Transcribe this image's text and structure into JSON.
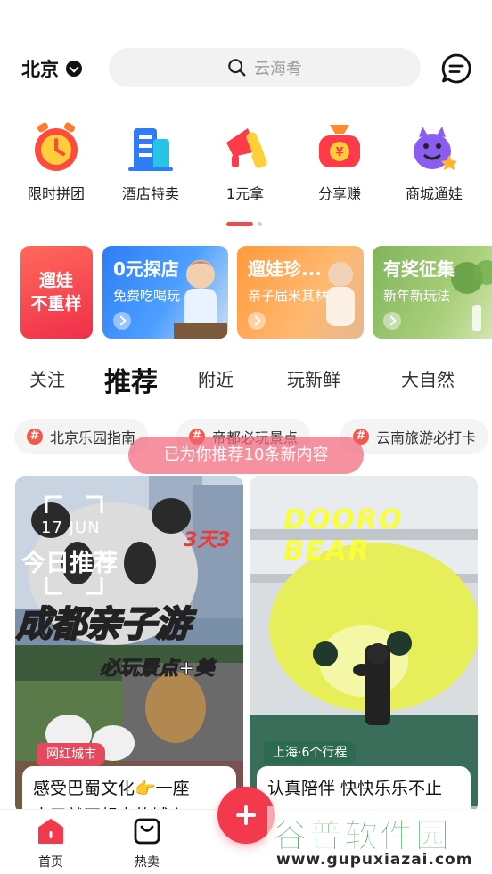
{
  "header": {
    "city": "北京",
    "search_placeholder": "云海肴"
  },
  "quick_entries": [
    {
      "label": "限时拼团",
      "icon": "alarm-clock-icon"
    },
    {
      "label": "酒店特卖",
      "icon": "hotel-building-icon"
    },
    {
      "label": "1元拿",
      "icon": "megaphone-icon"
    },
    {
      "label": "分享赚",
      "icon": "money-bag-icon"
    },
    {
      "label": "商城遛娃",
      "icon": "purple-monster-icon"
    }
  ],
  "carousel": {
    "pages": 2,
    "active_page": 1
  },
  "banners": [
    {
      "title": "遛娃\n不重样",
      "subtitle": ""
    },
    {
      "title": "0元探店",
      "subtitle": "免费吃喝玩"
    },
    {
      "title": "遛娃珍...",
      "subtitle": "亲子届米其林"
    },
    {
      "title": "有奖征集",
      "subtitle": "新年新玩法"
    }
  ],
  "feed_tabs": [
    "关注",
    "推荐",
    "附近",
    "玩新鲜",
    "大自然"
  ],
  "active_tab": "推荐",
  "topic_chips": [
    "北京乐园指南",
    "帝都必玩景点",
    "云南旅游必打卡"
  ],
  "toast": "已为你推荐10条新内容",
  "cards": [
    {
      "tag": "网红城市",
      "date": "17 JUN",
      "overlay_title": "今日推荐",
      "overlay_days": "3天3",
      "overlay_headline": "成都亲子游",
      "overlay_sub": "必玩景点+美",
      "title_line1": "感受巴蜀文化👉一座",
      "title_line2": "来了就不想走的城市"
    },
    {
      "tag": "上海·6个行程",
      "overlay_brand": "DOORO BEAR",
      "title_line1": "认真陪伴 快快乐乐不止",
      "title_line2": ""
    }
  ],
  "bottom_nav": [
    {
      "label": "首页",
      "icon": "home-icon",
      "active": true
    },
    {
      "label": "热卖",
      "icon": "shopping-bag-icon",
      "active": false
    }
  ],
  "watermark": {
    "line1": "谷普软件园",
    "line2": "www.gupuxiazai.com"
  },
  "colors": {
    "accent": "#f23a4c",
    "tab_underline": "#ff5a6a",
    "chip_hash": "#f5584a"
  }
}
